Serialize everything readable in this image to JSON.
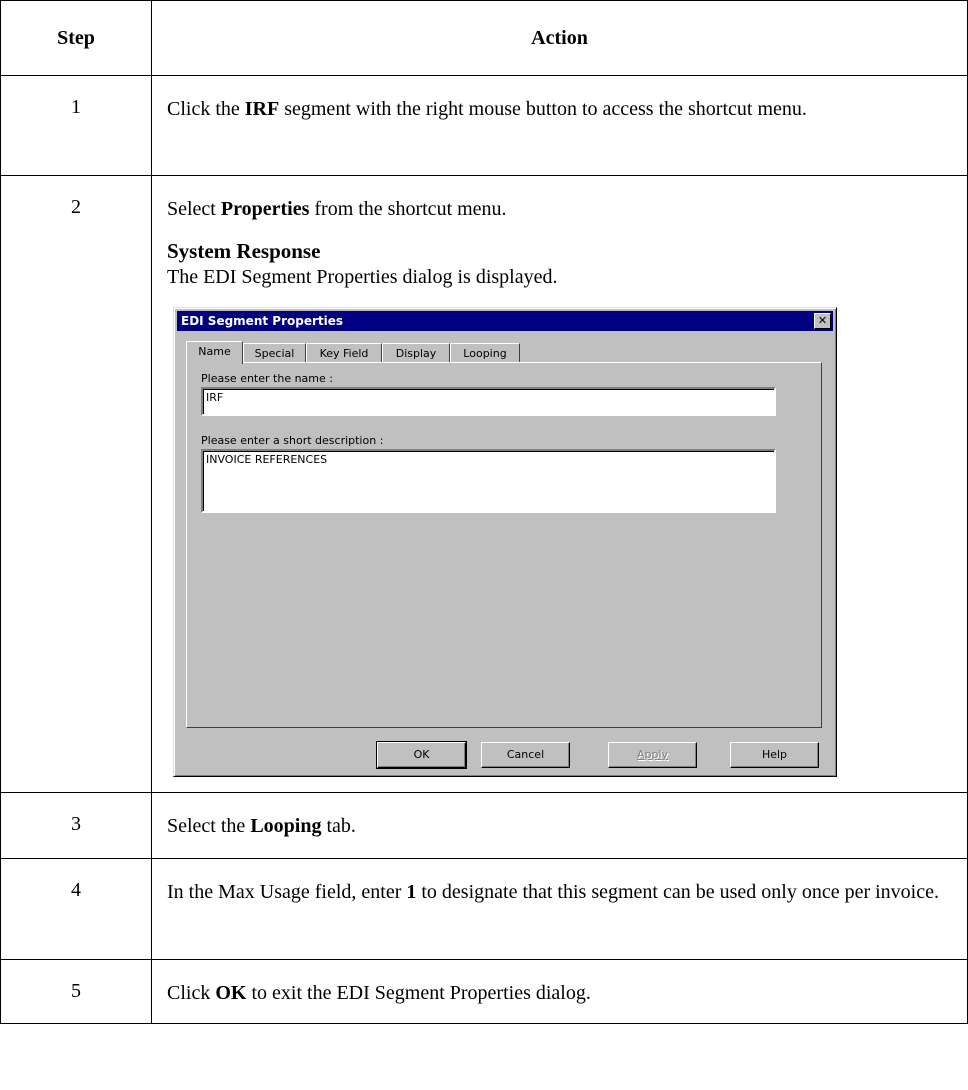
{
  "table": {
    "header_step": "Step",
    "header_action": "Action"
  },
  "steps": [
    {
      "num": "1",
      "pre": "Click the ",
      "bold": "IRF",
      "post": " segment with the right mouse button to access the shortcut menu."
    },
    {
      "num": "2",
      "pre": "Select ",
      "bold": "Properties",
      "post": " from the shortcut menu."
    },
    {
      "num": "3",
      "pre": "Select the ",
      "bold": "Looping",
      "post": " tab."
    },
    {
      "num": "4",
      "pre": "In the Max Usage field, enter ",
      "bold": "1",
      "post": " to designate that this segment can be used only once per invoice."
    },
    {
      "num": "5",
      "pre": "Click ",
      "bold": "OK",
      "post": " to exit the EDI Segment Properties dialog."
    }
  ],
  "system_response": {
    "heading": "System Response",
    "text": "The EDI Segment Properties dialog is displayed."
  },
  "dialog": {
    "title": "EDI Segment Properties",
    "close_glyph": "✕",
    "tabs": [
      "Name",
      "Special",
      "Key Field",
      "Display",
      "Looping"
    ],
    "name_label": "Please enter the name :",
    "name_value": "IRF",
    "desc_label": "Please enter a short description :",
    "desc_value": "INVOICE REFERENCES",
    "buttons": {
      "ok": "OK",
      "cancel": "Cancel",
      "apply": "Apply",
      "help": "Help"
    }
  }
}
